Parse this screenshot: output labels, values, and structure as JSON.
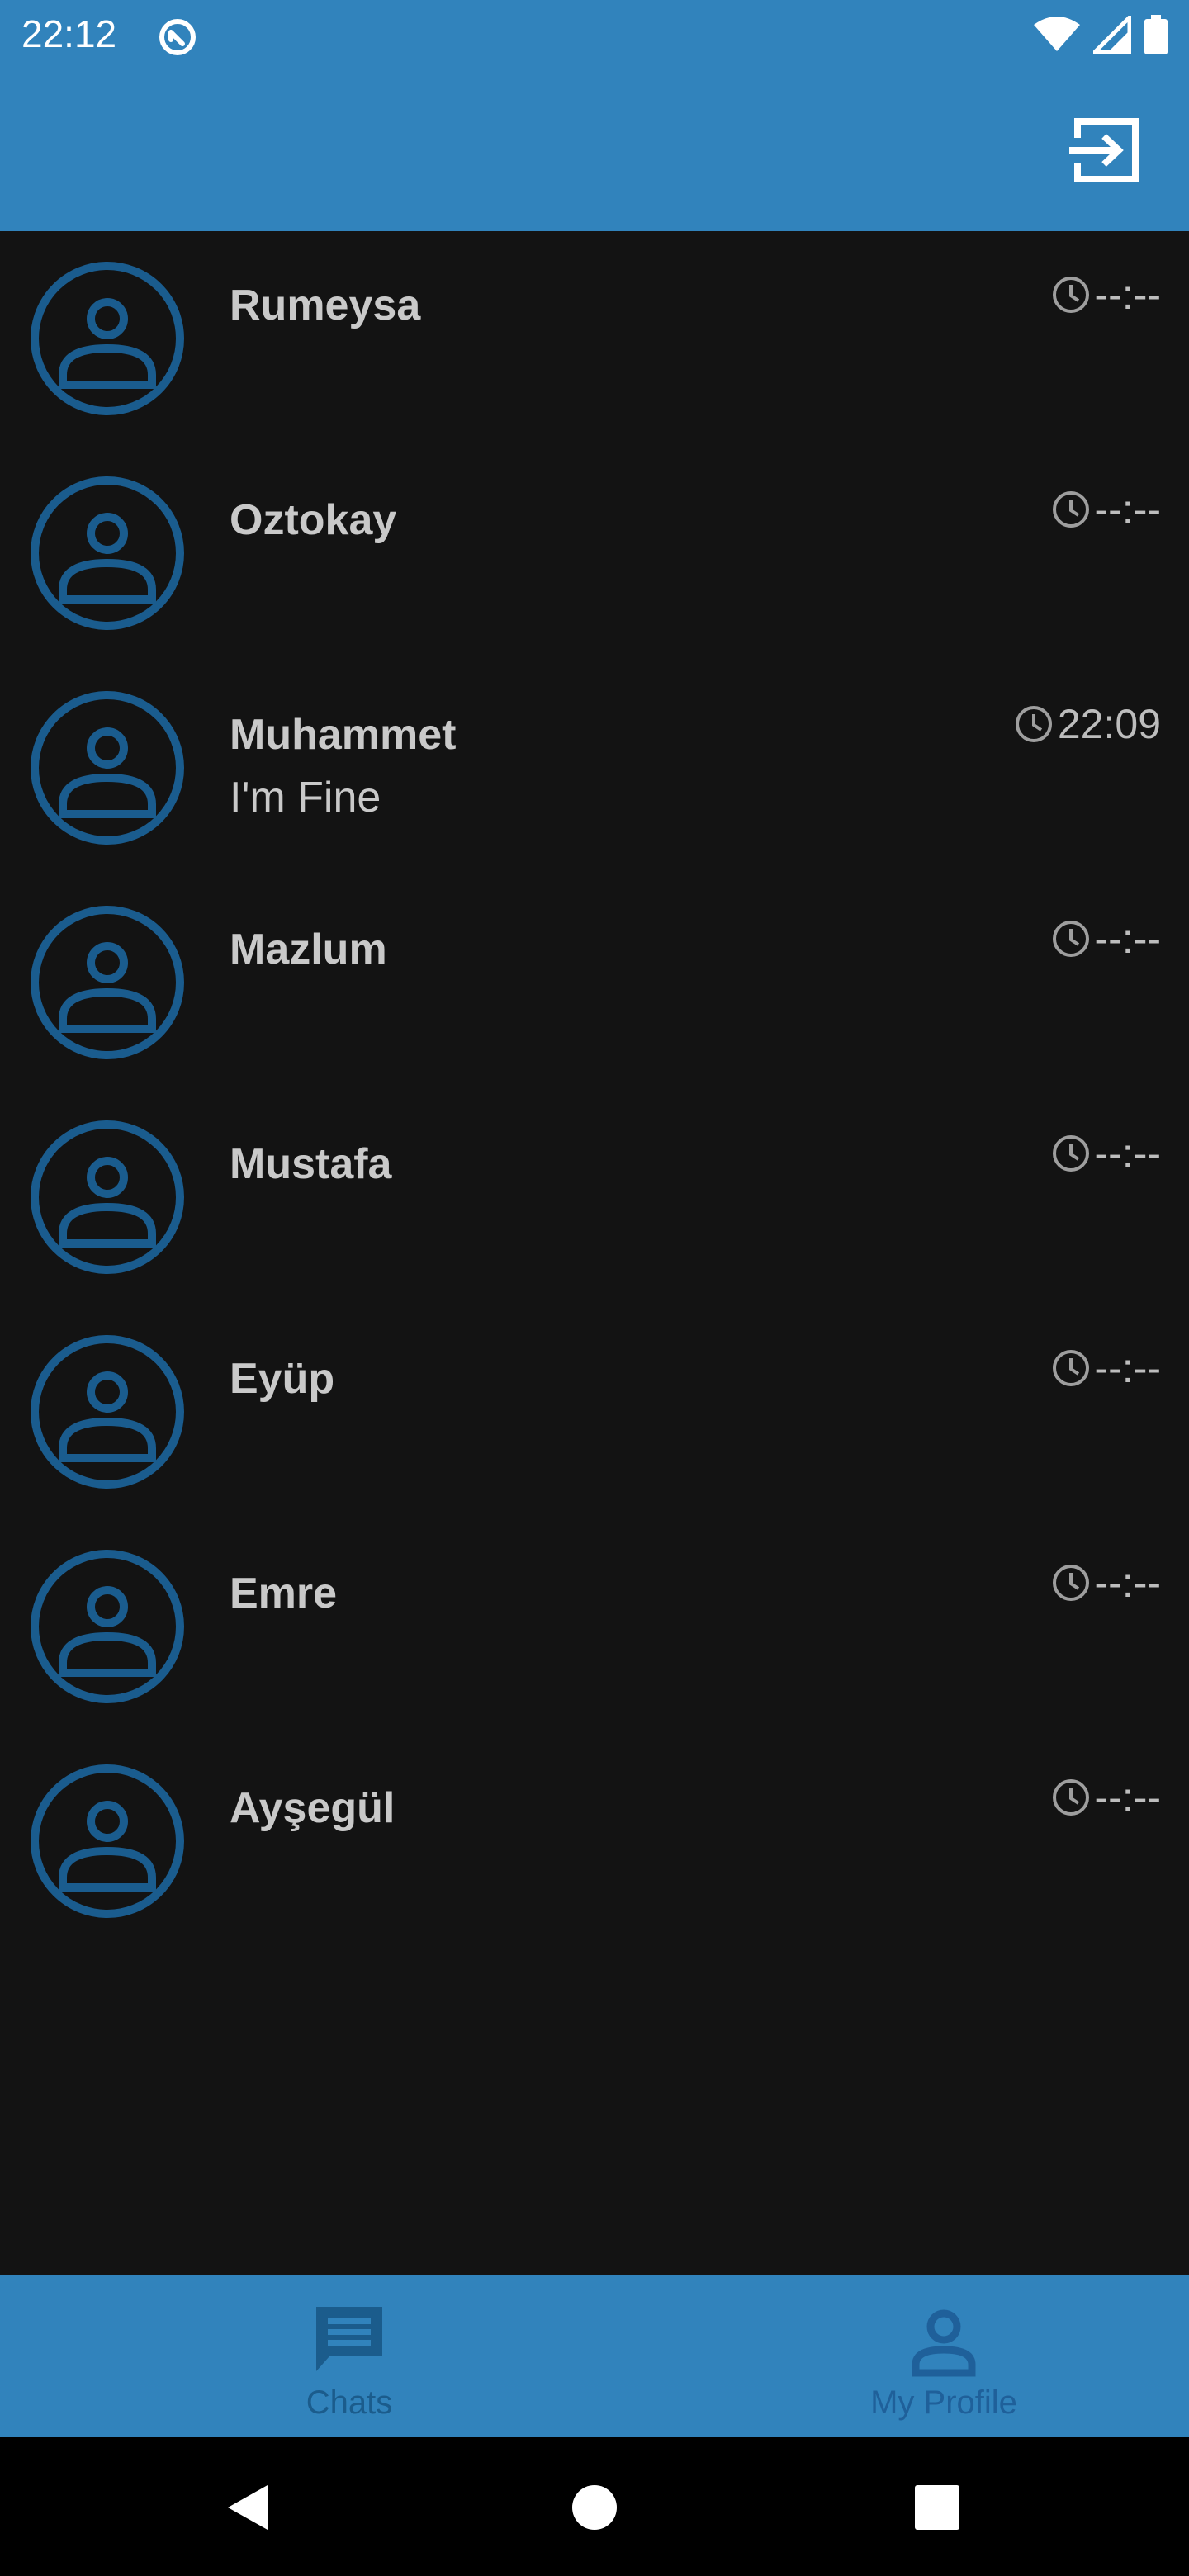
{
  "status_bar": {
    "time": "22:12"
  },
  "app_bar": {
    "action_icon": "logout-icon"
  },
  "chats": [
    {
      "name": "Rumeysa",
      "preview": "",
      "time": "--:--"
    },
    {
      "name": "Oztokay",
      "preview": "",
      "time": "--:--"
    },
    {
      "name": "Muhammet",
      "preview": "I'm Fine",
      "time": "22:09"
    },
    {
      "name": "Mazlum",
      "preview": "",
      "time": "--:--"
    },
    {
      "name": "Mustafa",
      "preview": "",
      "time": "--:--"
    },
    {
      "name": "Eyüp",
      "preview": "",
      "time": "--:--"
    },
    {
      "name": "Emre",
      "preview": "",
      "time": "--:--"
    },
    {
      "name": "Ayşegül",
      "preview": "",
      "time": "--:--"
    }
  ],
  "bottom_nav": {
    "tabs": [
      {
        "label": "Chats",
        "icon": "chat-icon",
        "selected": true
      },
      {
        "label": "My Profile",
        "icon": "person-icon",
        "selected": false
      }
    ]
  },
  "colors": {
    "primary": "#3183bc",
    "background": "#131313",
    "avatar": "#1a5c8e",
    "text": "#c9c9c9"
  }
}
